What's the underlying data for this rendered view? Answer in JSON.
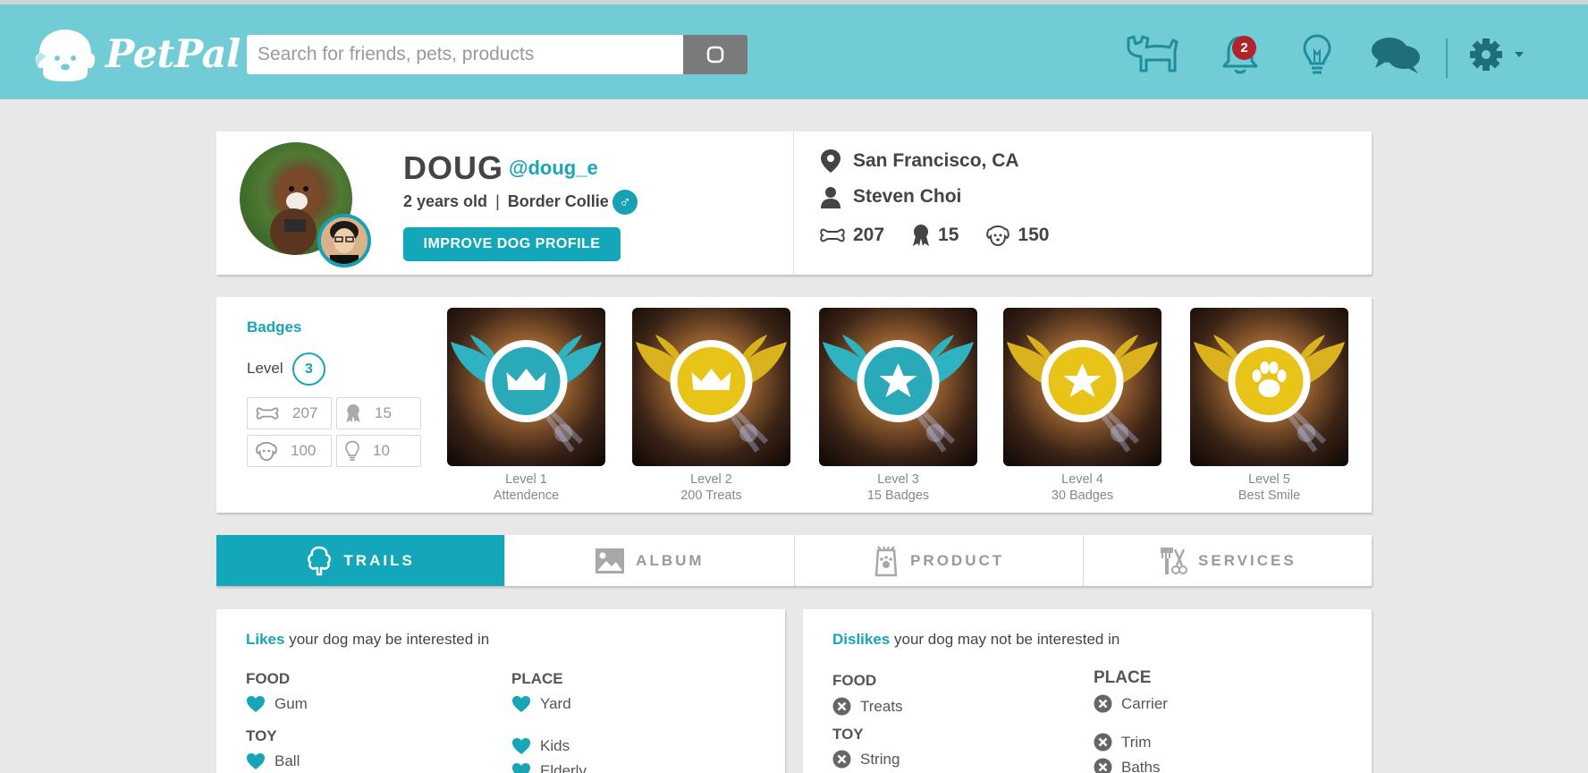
{
  "header": {
    "logo_text": "PetPal",
    "search": {
      "placeholder": "Search for friends, pets, products",
      "value": ""
    },
    "icons": [
      "dog-icon",
      "bell-icon",
      "lightbulb-icon",
      "chat-icon",
      "gear-icon"
    ],
    "notification_count": "2",
    "colors": {
      "navbar": "#71ccd6",
      "icon": "#1f8e9c",
      "accent": "#13a7b9"
    }
  },
  "profile": {
    "name": "DOUG",
    "handle": "@doug_e",
    "age": "2 years old",
    "separator": "|",
    "breed": "Border Collie",
    "gender_symbol": "♂",
    "improve_button": "IMPROVE DOG PROFILE",
    "location": "San Francisco, CA",
    "owner": "Steven Choi",
    "stats": {
      "treats": "207",
      "badges": "15",
      "friends": "150"
    }
  },
  "badges": {
    "title": "Badges",
    "level_label": "Level",
    "level_value": "3",
    "mini_stats": {
      "treats": "207",
      "badges": "15",
      "friends": "100",
      "ideas": "10"
    },
    "items": [
      {
        "level": "Level 1",
        "name": "Attendence",
        "wing_color": "#2fb3c2",
        "medal_color": "#2aa9b8",
        "emblem": "crown"
      },
      {
        "level": "Level 2",
        "name": "200 Treats",
        "wing_color": "#d9b21e",
        "medal_color": "#e8c418",
        "emblem": "crown"
      },
      {
        "level": "Level 3",
        "name": "15 Badges",
        "wing_color": "#2fb3c2",
        "medal_color": "#2aa9b8",
        "emblem": "star"
      },
      {
        "level": "Level 4",
        "name": "30 Badges",
        "wing_color": "#d9b21e",
        "medal_color": "#e8c418",
        "emblem": "star"
      },
      {
        "level": "Level 5",
        "name": "Best Smile",
        "wing_color": "#d9b21e",
        "medal_color": "#e8c418",
        "emblem": "paw"
      }
    ]
  },
  "tabs": [
    {
      "label": "TRAILS",
      "icon": "tree-icon",
      "active": true
    },
    {
      "label": "ALBUM",
      "icon": "image-icon",
      "active": false
    },
    {
      "label": "PRODUCT",
      "icon": "product-icon",
      "active": false
    },
    {
      "label": "SERVICES",
      "icon": "tools-icon",
      "active": false
    }
  ],
  "likes": {
    "title_strong": "Likes",
    "title_rest": " your dog may be interested in",
    "food_heading": "FOOD",
    "food": [
      "Gum"
    ],
    "toy_heading": "TOY",
    "toy": [
      "Ball"
    ],
    "place_heading": "PLACE",
    "place": [
      "Yard",
      "Kids",
      "Elderly"
    ]
  },
  "dislikes": {
    "title_strong": "Dislikes",
    "title_rest": " your dog may not be interested in",
    "food_heading": "FOOD",
    "food": [
      "Treats"
    ],
    "toy_heading": "TOY",
    "toy": [
      "String"
    ],
    "place_heading": "PLACE",
    "place": [
      "Carrier",
      "Trim",
      "Baths"
    ]
  }
}
